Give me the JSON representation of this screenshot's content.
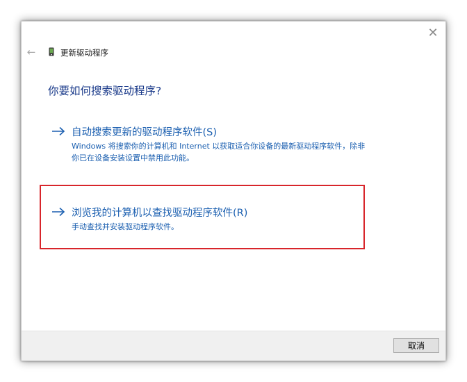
{
  "window": {
    "title": "更新驱动程序",
    "close_glyph": "✕",
    "back_glyph": "←"
  },
  "question": "你要如何搜索驱动程序?",
  "options": [
    {
      "title": "自动搜索更新的驱动程序软件(S)",
      "description": "Windows 将搜索你的计算机和 Internet 以获取适合你设备的最新驱动程序软件，除非你已在设备安装设置中禁用此功能。"
    },
    {
      "title": "浏览我的计算机以查找驱动程序软件(R)",
      "description": "手动查找并安装驱动程序软件。"
    }
  ],
  "footer": {
    "cancel_label": "取消"
  },
  "colors": {
    "link": "#1b5fb0",
    "heading": "#1a3a8a",
    "highlight_border": "#d8252b"
  },
  "icons": {
    "back": "back-arrow-icon",
    "device": "device-icon",
    "close": "close-icon",
    "option_arrow": "right-arrow-icon"
  }
}
